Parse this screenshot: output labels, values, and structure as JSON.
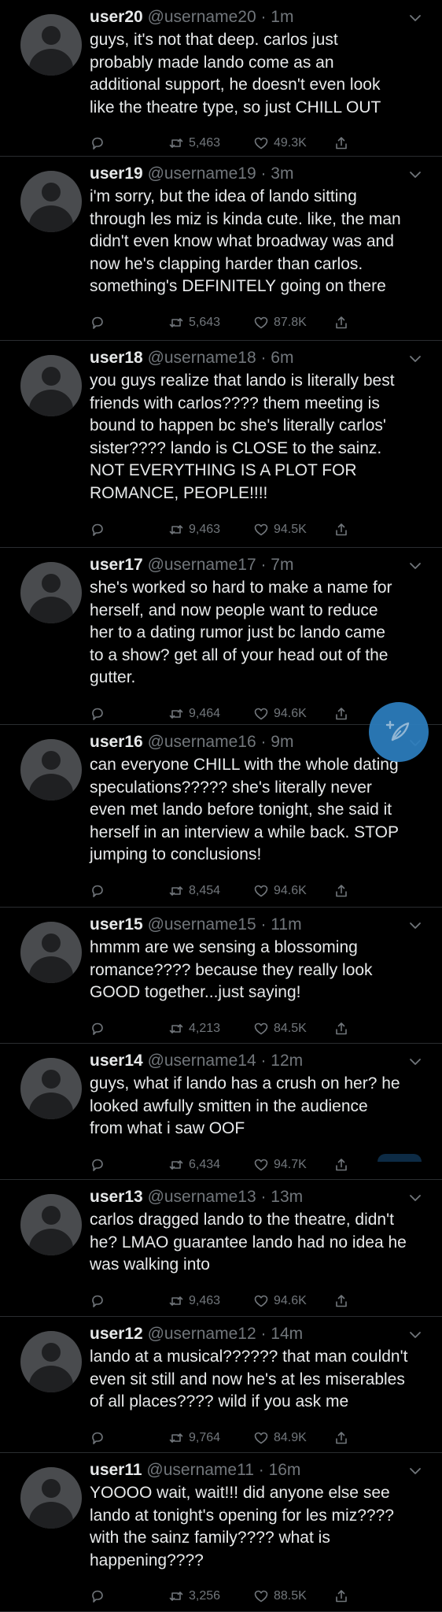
{
  "tweets": [
    {
      "name": "user20",
      "handle": "@username20",
      "time": "1m",
      "text": "guys, it's not that deep. carlos just\nprobably made lando come as an\nadditional support, he doesn't even look\nlike the theatre type, so just CHILL OUT",
      "retweets": "5,463",
      "likes": "49.3K"
    },
    {
      "name": "user19",
      "handle": "@username19",
      "time": "3m",
      "text": "i'm sorry, but the idea of lando sitting\nthrough les miz is kinda cute. like, the man\ndidn't even know what broadway was and\nnow he's clapping harder than carlos.\nsomething's DEFINITELY going on there",
      "retweets": "5,643",
      "likes": "87.8K"
    },
    {
      "name": "user18",
      "handle": "@username18",
      "time": "6m",
      "text": "you guys realize that lando is literally best\nfriends with carlos???? them meeting is\nbound to happen bc she's literally carlos'\nsister???? lando is CLOSE to the sainz.\nNOT EVERYTHING IS A PLOT FOR\nROMANCE, PEOPLE!!!!",
      "retweets": "9,463",
      "likes": "94.5K"
    },
    {
      "name": "user17",
      "handle": "@username17",
      "time": "7m",
      "text": "she's worked so hard to make a name for\nherself, and now people want to reduce\nher to a dating rumor just bc lando came\nto a show? get all of your head out of the\ngutter.",
      "retweets": "9,464",
      "likes": "94.6K"
    },
    {
      "name": "user16",
      "handle": "@username16",
      "time": "9m",
      "text": "can everyone CHILL with the whole dating\nspeculations????? she's literally never\neven met lando before tonight, she said it\nherself in an interview a while back. STOP\njumping to conclusions!",
      "retweets": "8,454",
      "likes": "94.6K"
    },
    {
      "name": "user15",
      "handle": "@username15",
      "time": "11m",
      "text": "hmmm are we sensing a blossoming\nromance???? because they really look\nGOOD together...just saying!",
      "retweets": "4,213",
      "likes": "84.5K"
    },
    {
      "name": "user14",
      "handle": "@username14",
      "time": "12m",
      "text": "guys, what if lando has a crush on her? he\nlooked awfully smitten in the audience\nfrom what i saw OOF",
      "retweets": "6,434",
      "likes": "94.7K"
    },
    {
      "name": "user13",
      "handle": "@username13",
      "time": "13m",
      "text": "carlos dragged lando to the theatre, didn't\nhe? LMAO guarantee lando had no idea he\nwas walking into",
      "retweets": "9,463",
      "likes": "94.6K"
    },
    {
      "name": "user12",
      "handle": "@username12",
      "time": "14m",
      "text": "lando at a musical?????? that man couldn't\neven sit still and now he's at les miserables\nof all places???? wild if you ask me",
      "retweets": "9,764",
      "likes": "84.9K"
    },
    {
      "name": "user11",
      "handle": "@username11",
      "time": "16m",
      "text": "YOOOO wait, wait!!! did anyone else see\nlando at tonight's opening for les miz????\nwith the sainz family???? what is\nhappening????",
      "retweets": "3,256",
      "likes": "88.5K"
    }
  ]
}
